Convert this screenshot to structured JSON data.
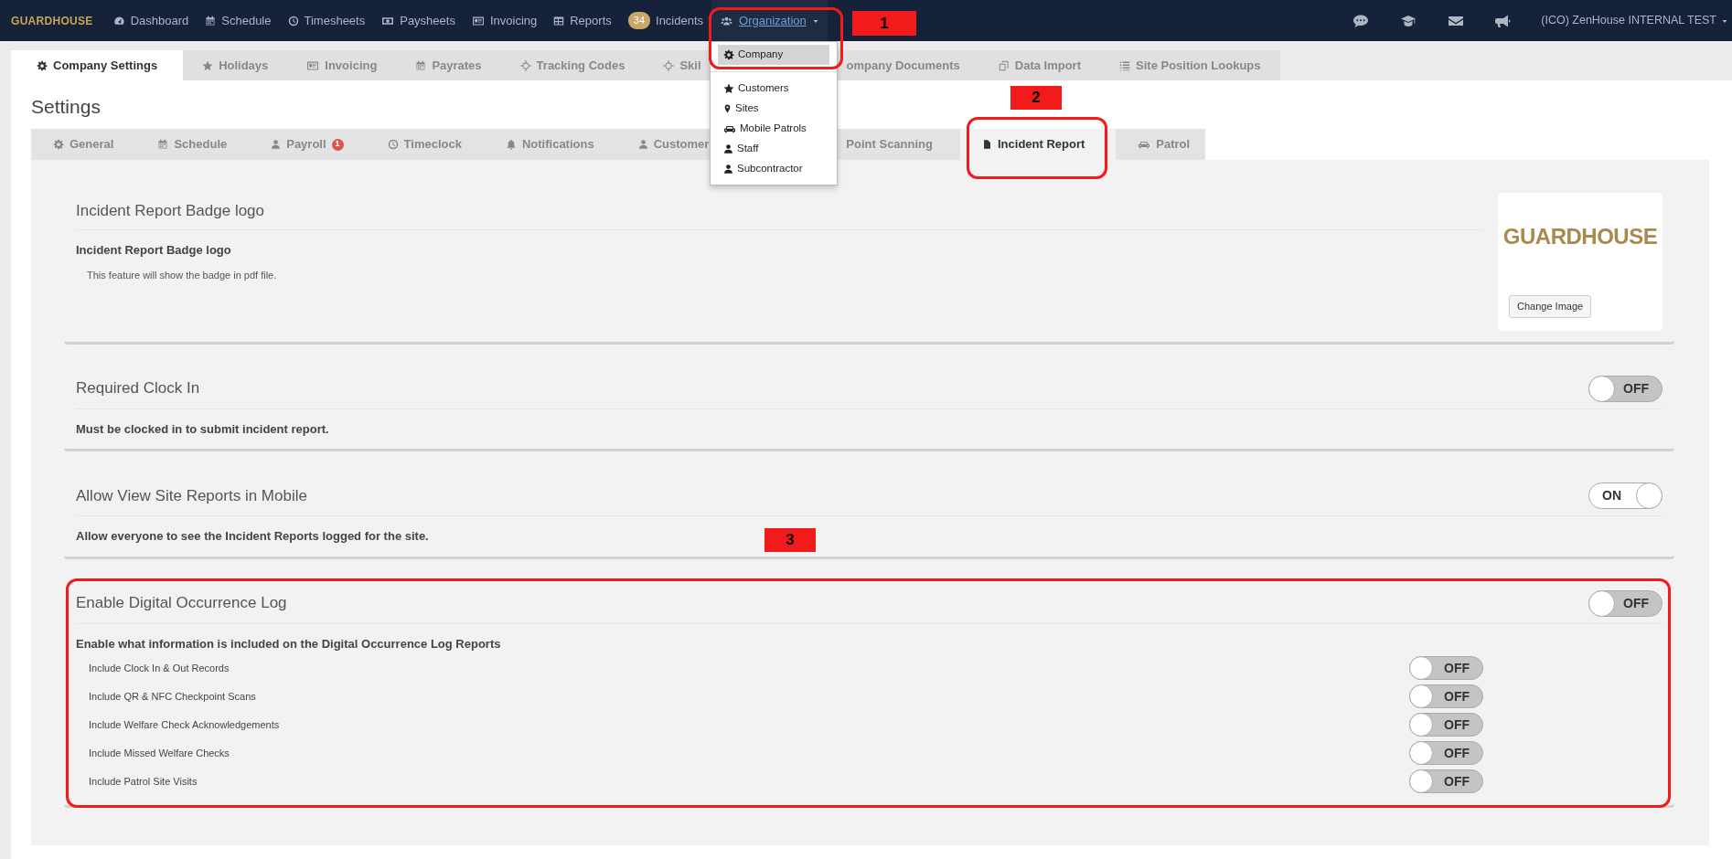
{
  "navbar": {
    "brand": "GUARDHOUSE",
    "items": [
      {
        "label": "Dashboard",
        "selected": false
      },
      {
        "label": "Schedule",
        "selected": false
      },
      {
        "label": "Timesheets",
        "selected": false
      },
      {
        "label": "Paysheets",
        "selected": false
      },
      {
        "label": "Invoicing",
        "selected": false
      },
      {
        "label": "Reports",
        "selected": false
      },
      {
        "label": "Incidents",
        "badge": "34",
        "selected": false
      },
      {
        "label": "Organization",
        "selected": true,
        "expanded": true
      }
    ],
    "user": "(ICO) ZenHouse INTERNAL TEST"
  },
  "organization_menu": [
    {
      "label": "Company",
      "selected": true
    },
    {
      "label": "Customers",
      "selected": false
    },
    {
      "label": "Sites",
      "selected": false
    },
    {
      "label": "Mobile Patrols",
      "selected": false
    },
    {
      "label": "Staff",
      "selected": false
    },
    {
      "label": "Subcontractor",
      "selected": false
    }
  ],
  "tabs": [
    {
      "label": "Company Settings",
      "selected": true
    },
    {
      "label": "Holidays",
      "selected": false
    },
    {
      "label": "Invoicing",
      "selected": false
    },
    {
      "label": "Payrates",
      "selected": false
    },
    {
      "label": "Tracking Codes",
      "selected": false
    },
    {
      "label": "Skil",
      "selected": false
    },
    {
      "label": "ompany Documents",
      "selected": false
    },
    {
      "label": "Data Import",
      "selected": false
    },
    {
      "label": "Site Position Lookups",
      "selected": false
    }
  ],
  "page_title": "Settings",
  "subtabs": [
    {
      "label": "General",
      "selected": false
    },
    {
      "label": "Schedule",
      "selected": false
    },
    {
      "label": "Payroll",
      "badge": "1",
      "selected": false
    },
    {
      "label": "Timeclock",
      "selected": false
    },
    {
      "label": "Notifications",
      "selected": false
    },
    {
      "label": "Customer",
      "selected": false
    },
    {
      "label": "Point Scanning",
      "selected": false
    },
    {
      "label": "Incident Report",
      "selected": true
    },
    {
      "label": "Patrol",
      "selected": false
    }
  ],
  "sections": [
    {
      "kind": "logo",
      "title": "Incident Report Badge logo",
      "heading": "Incident Report Badge logo",
      "description": "This feature will show the badge in pdf file.",
      "logo_text": "GUARDHOUSE",
      "button": "Change Image"
    },
    {
      "kind": "toggle",
      "title": "Required Clock In",
      "toggle": {
        "on": false,
        "label": "OFF"
      },
      "heading": "Must be clocked in to submit incident report."
    },
    {
      "kind": "toggle",
      "title": "Allow View Site Reports in Mobile",
      "toggle": {
        "on": true,
        "label": "ON"
      },
      "heading": "Allow everyone to see the Incident Reports logged for the site."
    },
    {
      "kind": "toggle",
      "title": "Enable Digital Occurrence Log",
      "toggle": {
        "on": false,
        "label": "OFF"
      },
      "heading": "Enable what information is included on the Digital Occurrence Log Reports",
      "options": [
        {
          "label": "Include Clock In & Out Records",
          "on": false,
          "state": "OFF"
        },
        {
          "label": "Include QR & NFC Checkpoint Scans",
          "on": false,
          "state": "OFF"
        },
        {
          "label": "Include Welfare Check Acknowledgements",
          "on": false,
          "state": "OFF"
        },
        {
          "label": "Include Missed Welfare Checks",
          "on": false,
          "state": "OFF"
        },
        {
          "label": "Include Patrol Site Visits",
          "on": false,
          "state": "OFF"
        }
      ]
    }
  ],
  "annotations": [
    {
      "label": "1"
    },
    {
      "label": "2"
    },
    {
      "label": "3"
    }
  ]
}
